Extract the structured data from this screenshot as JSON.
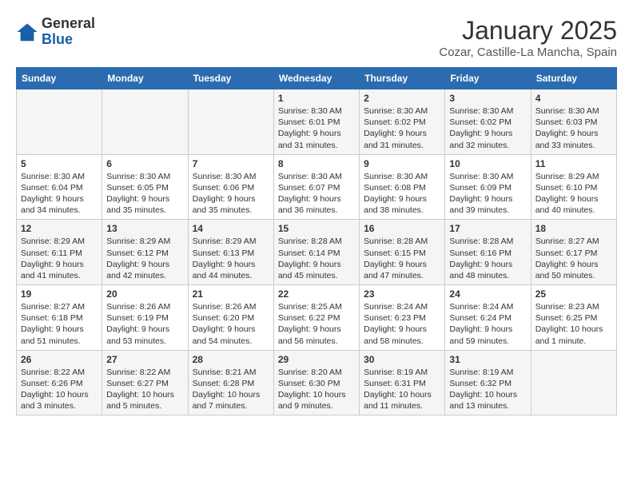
{
  "header": {
    "logo_general": "General",
    "logo_blue": "Blue",
    "title": "January 2025",
    "subtitle": "Cozar, Castille-La Mancha, Spain"
  },
  "weekdays": [
    "Sunday",
    "Monday",
    "Tuesday",
    "Wednesday",
    "Thursday",
    "Friday",
    "Saturday"
  ],
  "weeks": [
    [
      {
        "day": "",
        "info": ""
      },
      {
        "day": "",
        "info": ""
      },
      {
        "day": "",
        "info": ""
      },
      {
        "day": "1",
        "info": "Sunrise: 8:30 AM\nSunset: 6:01 PM\nDaylight: 9 hours and 31 minutes."
      },
      {
        "day": "2",
        "info": "Sunrise: 8:30 AM\nSunset: 6:02 PM\nDaylight: 9 hours and 31 minutes."
      },
      {
        "day": "3",
        "info": "Sunrise: 8:30 AM\nSunset: 6:02 PM\nDaylight: 9 hours and 32 minutes."
      },
      {
        "day": "4",
        "info": "Sunrise: 8:30 AM\nSunset: 6:03 PM\nDaylight: 9 hours and 33 minutes."
      }
    ],
    [
      {
        "day": "5",
        "info": "Sunrise: 8:30 AM\nSunset: 6:04 PM\nDaylight: 9 hours and 34 minutes."
      },
      {
        "day": "6",
        "info": "Sunrise: 8:30 AM\nSunset: 6:05 PM\nDaylight: 9 hours and 35 minutes."
      },
      {
        "day": "7",
        "info": "Sunrise: 8:30 AM\nSunset: 6:06 PM\nDaylight: 9 hours and 35 minutes."
      },
      {
        "day": "8",
        "info": "Sunrise: 8:30 AM\nSunset: 6:07 PM\nDaylight: 9 hours and 36 minutes."
      },
      {
        "day": "9",
        "info": "Sunrise: 8:30 AM\nSunset: 6:08 PM\nDaylight: 9 hours and 38 minutes."
      },
      {
        "day": "10",
        "info": "Sunrise: 8:30 AM\nSunset: 6:09 PM\nDaylight: 9 hours and 39 minutes."
      },
      {
        "day": "11",
        "info": "Sunrise: 8:29 AM\nSunset: 6:10 PM\nDaylight: 9 hours and 40 minutes."
      }
    ],
    [
      {
        "day": "12",
        "info": "Sunrise: 8:29 AM\nSunset: 6:11 PM\nDaylight: 9 hours and 41 minutes."
      },
      {
        "day": "13",
        "info": "Sunrise: 8:29 AM\nSunset: 6:12 PM\nDaylight: 9 hours and 42 minutes."
      },
      {
        "day": "14",
        "info": "Sunrise: 8:29 AM\nSunset: 6:13 PM\nDaylight: 9 hours and 44 minutes."
      },
      {
        "day": "15",
        "info": "Sunrise: 8:28 AM\nSunset: 6:14 PM\nDaylight: 9 hours and 45 minutes."
      },
      {
        "day": "16",
        "info": "Sunrise: 8:28 AM\nSunset: 6:15 PM\nDaylight: 9 hours and 47 minutes."
      },
      {
        "day": "17",
        "info": "Sunrise: 8:28 AM\nSunset: 6:16 PM\nDaylight: 9 hours and 48 minutes."
      },
      {
        "day": "18",
        "info": "Sunrise: 8:27 AM\nSunset: 6:17 PM\nDaylight: 9 hours and 50 minutes."
      }
    ],
    [
      {
        "day": "19",
        "info": "Sunrise: 8:27 AM\nSunset: 6:18 PM\nDaylight: 9 hours and 51 minutes."
      },
      {
        "day": "20",
        "info": "Sunrise: 8:26 AM\nSunset: 6:19 PM\nDaylight: 9 hours and 53 minutes."
      },
      {
        "day": "21",
        "info": "Sunrise: 8:26 AM\nSunset: 6:20 PM\nDaylight: 9 hours and 54 minutes."
      },
      {
        "day": "22",
        "info": "Sunrise: 8:25 AM\nSunset: 6:22 PM\nDaylight: 9 hours and 56 minutes."
      },
      {
        "day": "23",
        "info": "Sunrise: 8:24 AM\nSunset: 6:23 PM\nDaylight: 9 hours and 58 minutes."
      },
      {
        "day": "24",
        "info": "Sunrise: 8:24 AM\nSunset: 6:24 PM\nDaylight: 9 hours and 59 minutes."
      },
      {
        "day": "25",
        "info": "Sunrise: 8:23 AM\nSunset: 6:25 PM\nDaylight: 10 hours and 1 minute."
      }
    ],
    [
      {
        "day": "26",
        "info": "Sunrise: 8:22 AM\nSunset: 6:26 PM\nDaylight: 10 hours and 3 minutes."
      },
      {
        "day": "27",
        "info": "Sunrise: 8:22 AM\nSunset: 6:27 PM\nDaylight: 10 hours and 5 minutes."
      },
      {
        "day": "28",
        "info": "Sunrise: 8:21 AM\nSunset: 6:28 PM\nDaylight: 10 hours and 7 minutes."
      },
      {
        "day": "29",
        "info": "Sunrise: 8:20 AM\nSunset: 6:30 PM\nDaylight: 10 hours and 9 minutes."
      },
      {
        "day": "30",
        "info": "Sunrise: 8:19 AM\nSunset: 6:31 PM\nDaylight: 10 hours and 11 minutes."
      },
      {
        "day": "31",
        "info": "Sunrise: 8:19 AM\nSunset: 6:32 PM\nDaylight: 10 hours and 13 minutes."
      },
      {
        "day": "",
        "info": ""
      }
    ]
  ]
}
